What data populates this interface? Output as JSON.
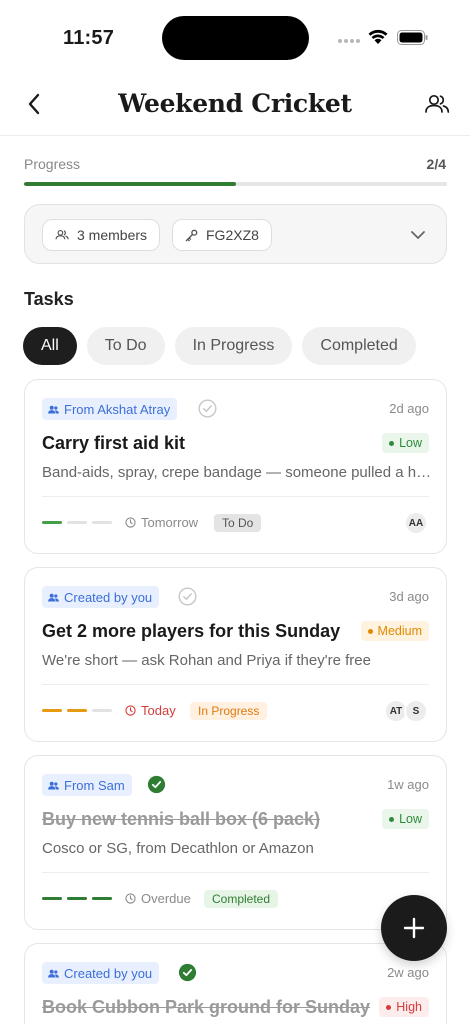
{
  "status_bar": {
    "time": "11:57"
  },
  "header": {
    "title": "Weekend Cricket"
  },
  "progress": {
    "label": "Progress",
    "count": "2/4",
    "fraction": 0.5,
    "color": "#2e7d32"
  },
  "group": {
    "members": "3 members",
    "code": "FG2XZ8"
  },
  "tasks_section": {
    "title": "Tasks"
  },
  "filters": [
    {
      "label": "All",
      "active": true
    },
    {
      "label": "To Do",
      "active": false
    },
    {
      "label": "In Progress",
      "active": false
    },
    {
      "label": "Completed",
      "active": false
    }
  ],
  "tasks": [
    {
      "origin": "From Akshat Atray",
      "verified": false,
      "time_ago": "2d ago",
      "title": "Carry first aid kit",
      "priority": "Low",
      "description": "Band-aids, spray, crepe bandage — someone pulled a hamstring last week",
      "steps_done": 1,
      "steps_color": "#43a047",
      "due": "Tomorrow",
      "status": "To Do",
      "assignees": [
        "AA"
      ]
    },
    {
      "origin": "Created by you",
      "verified": false,
      "time_ago": "3d ago",
      "title": "Get 2 more players for this Sunday",
      "priority": "Medium",
      "description": "We're short — ask Rohan and Priya if they're free",
      "steps_done": 2,
      "steps_color": "#e59a12",
      "due": "Today",
      "status": "In Progress",
      "assignees": [
        "AT",
        "S"
      ]
    },
    {
      "origin": "From Sam",
      "verified": true,
      "time_ago": "1w ago",
      "title": "Buy new tennis ball box (6 pack)",
      "priority": "Low",
      "description": "Cosco or SG, from Decathlon or Amazon",
      "steps_done": 3,
      "steps_color": "#2e7d32",
      "due": "Overdue",
      "status": "Completed",
      "assignees": []
    },
    {
      "origin": "Created by you",
      "verified": true,
      "time_ago": "2w ago",
      "title": "Book Cubbon Park ground for Sunday",
      "priority": "High",
      "completed": true
    }
  ],
  "icons": {
    "back": "chevron-left-icon",
    "members": "users-icon",
    "key": "key-icon",
    "chevron": "chevron-down-icon",
    "clock": "clock-icon",
    "check": "check-circle-icon",
    "add": "plus-icon"
  }
}
